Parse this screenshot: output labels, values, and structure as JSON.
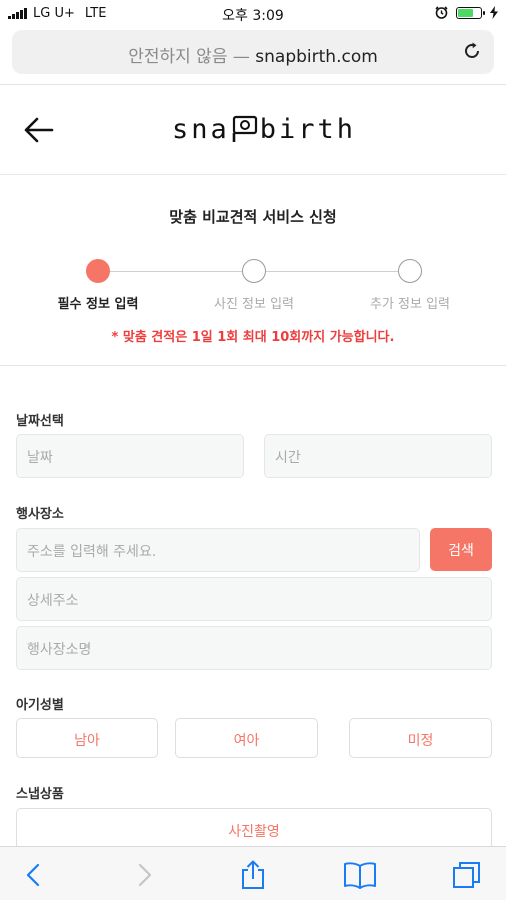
{
  "status_bar": {
    "carrier": "LG U+",
    "network": "LTE",
    "time": "오후 3:09"
  },
  "browser": {
    "security_label": "안전하지 않음 —",
    "domain": "snapbirth.com"
  },
  "header": {
    "logo_left": "sna",
    "logo_right": "birth"
  },
  "form": {
    "title": "맞춤 비교견적 서비스 신청",
    "steps": [
      {
        "label": "필수 정보 입력",
        "active": true
      },
      {
        "label": "사진 정보 입력",
        "active": false
      },
      {
        "label": "추가 정보 입력",
        "active": false
      }
    ],
    "notice": "* 맞춤 견적은 1일 1회 최대 10회까지 가능합니다.",
    "date_section": {
      "label": "날짜선택",
      "date_placeholder": "날짜",
      "time_placeholder": "시간"
    },
    "venue_section": {
      "label": "행사장소",
      "address_placeholder": "주소를 입력해 주세요.",
      "search_button": "검색",
      "detail_placeholder": "상세주소",
      "venue_name_placeholder": "행사장소명"
    },
    "gender_section": {
      "label": "아기성별",
      "options": [
        "남아",
        "여아",
        "미정"
      ]
    },
    "product_section": {
      "label": "스냅상품",
      "option": "사진촬영"
    }
  },
  "toolbar": {
    "icons": [
      "back-icon",
      "forward-icon",
      "share-icon",
      "bookmarks-icon",
      "tabs-icon"
    ]
  },
  "colors": {
    "accent": "#f57566",
    "notice": "#ee3d3d",
    "ios_blue": "#1a7cf5"
  }
}
